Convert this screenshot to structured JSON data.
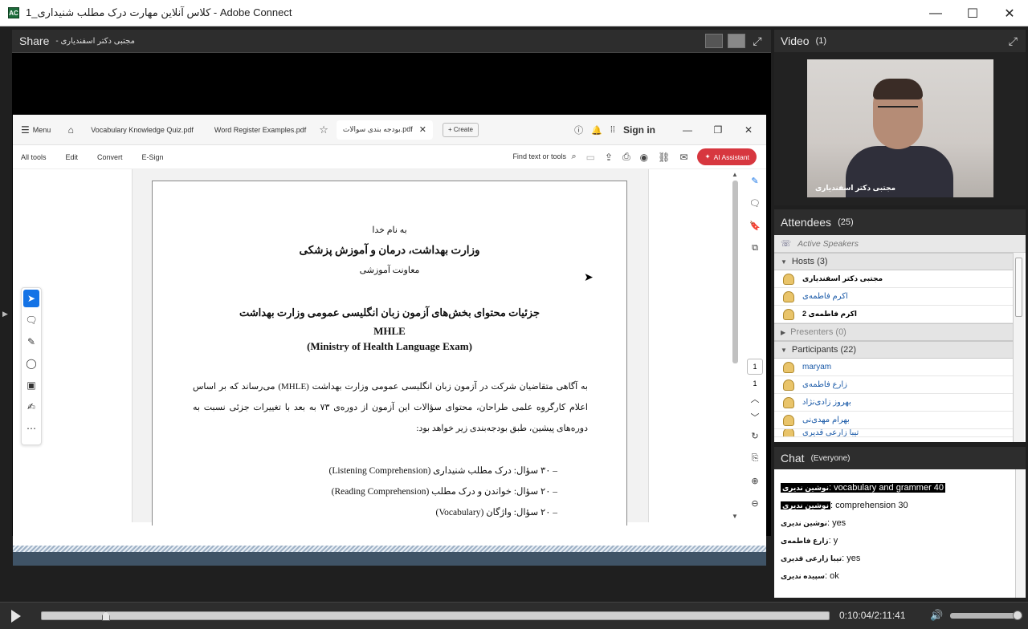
{
  "window": {
    "title": "کلاس آنلاین مهارت درک مطلب شنیداری_1 - Adobe Connect",
    "controls": {
      "minimize": "—",
      "maximize": "☐",
      "close": "✕"
    }
  },
  "share": {
    "title": "Share",
    "presenter": "- مجتبی دکتر اسفندیاری",
    "acrobat": {
      "menu": "Menu",
      "tabs": [
        "Vocabulary Knowledge Quiz.pdf",
        "Word Register Examples.pdf",
        "بودجه بندی سوالات.pdf"
      ],
      "create": "+ Create",
      "sign_in": "Sign in",
      "toolbar": [
        "All tools",
        "Edit",
        "Convert",
        "E-Sign"
      ],
      "find": "Find text or tools",
      "ai_assistant": "AI Assistant",
      "page_current": "1",
      "page_total": "1"
    },
    "document": {
      "bismillah": "به نام خدا",
      "ministry": "وزارت بهداشت، درمان و آموزش پزشکی",
      "deputy": "معاونت آموزشی",
      "heading": "جزئیات محتوای بخش‌های آزمون زبان انگلیسی عمومی وزارت بهداشت",
      "abbr": "MHLE",
      "full_name": "(Ministry of Health Language Exam)",
      "paragraph": "به آگاهی متقاضیان شرکت در آزمون زبان انگلیسی عمومی وزارت بهداشت (MHLE) می‌رساند که بر اساس اعلام کارگروه علمی طراحان، محتوای سؤالات این آزمون از دوره‌ی ۷۳ به بعد با تغییرات جزئی نسبت به دوره‌های پیشین، طبق بودجه‌بندی زیر خواهد بود:",
      "items": [
        "–    ۳۰ سؤال: درک مطلب شنیداری (Listening Comprehension)",
        "–    ۲۰ سؤال: خواندن و درک مطلب (Reading Comprehension)",
        "–    ۲۰ سؤال: واژگان (Vocabulary)"
      ]
    }
  },
  "video": {
    "title": "Video",
    "count": "(1)",
    "caption": "مجتبی دکتر اسفندیاری"
  },
  "attendees": {
    "title": "Attendees",
    "count": "(25)",
    "active_speakers": "Active Speakers",
    "hosts_label": "Hosts (3)",
    "hosts": [
      "مجتبی دکتر اسفندیاری",
      "اکرم فاطمه‌ی",
      "اکرم فاطمه‌ی 2"
    ],
    "presenters_label": "Presenters (0)",
    "participants_label": "Participants (22)",
    "participants": [
      "maryam",
      "زارع فاطمه‌ی",
      "بهروز زادی‌نژاد",
      "بهرام مهدی‌نی",
      "تیبا زارعی قدیری"
    ]
  },
  "chat": {
    "title": "Chat",
    "scope": "(Everyone)",
    "messages": [
      {
        "who": "نوشین ندیری",
        "text": ": vocabulary and grammer 40"
      },
      {
        "who": "نوشین ندیری",
        "text": ": comprehension 30"
      },
      {
        "who": "نوشین ندیری",
        "text": ": yes"
      },
      {
        "who": "زارع فاطمه‌ی",
        "text": ": y"
      },
      {
        "who": "تیبا زارعی قدیری",
        "text": ": yes"
      },
      {
        "who": "سپیده ندیری",
        "text": ": ok"
      }
    ]
  },
  "playback": {
    "progress": 0.077,
    "time": "0:10:04/2:11:41",
    "volume": 1.0
  },
  "colors": {
    "accent": "#1473e6",
    "ai_button": "#d7373f",
    "pod_header": "#2d2d2d"
  }
}
